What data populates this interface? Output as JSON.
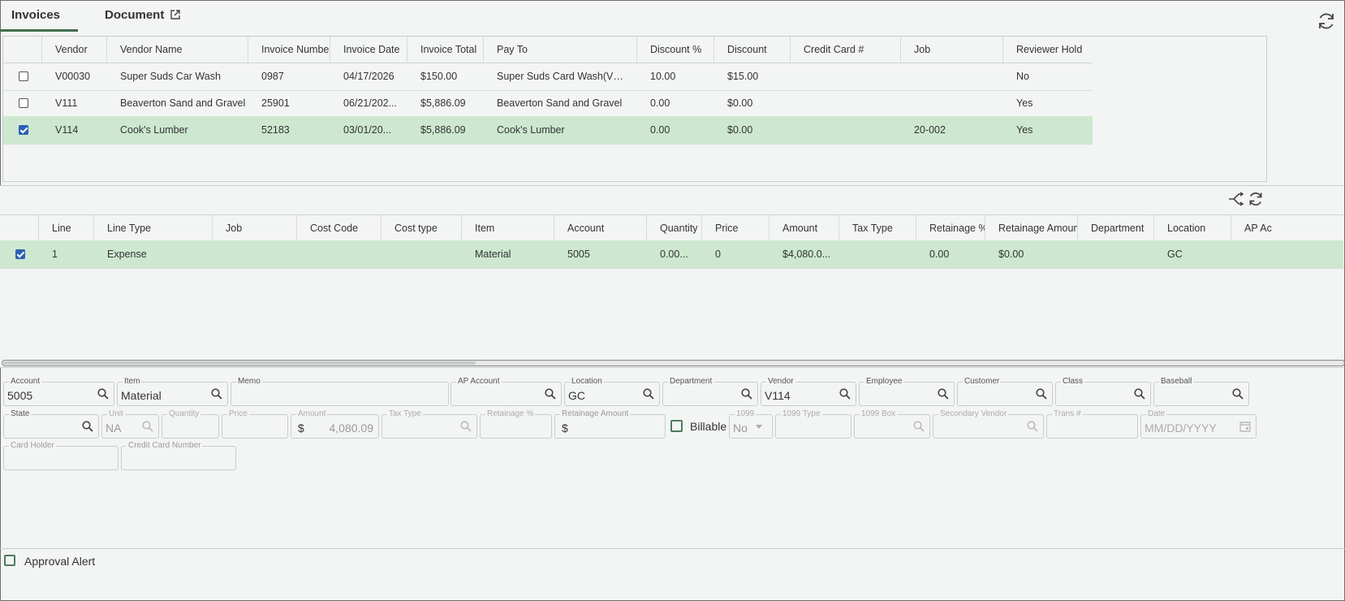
{
  "tabs": [
    {
      "label": "Invoices"
    },
    {
      "label": "Document"
    }
  ],
  "invoices": {
    "columns": [
      "Vendor",
      "Vendor Name",
      "Invoice Number",
      "Invoice Date",
      "Invoice Total",
      "Pay To",
      "Discount %",
      "Discount",
      "Credit Card #",
      "Job",
      "Reviewer Hold"
    ],
    "rows": [
      {
        "checked": false,
        "cells": [
          "V00030",
          "Super Suds Car Wash",
          "0987",
          "04/17/2026",
          "$150.00",
          "Super Suds Card Wash(VV0...",
          "10.00",
          "$15.00",
          "",
          "",
          "No"
        ]
      },
      {
        "checked": false,
        "cells": [
          "V111",
          "Beaverton Sand and Gravel",
          "25901",
          "06/21/202...",
          "$5,886.09",
          "Beaverton Sand and Gravel",
          "0.00",
          "$0.00",
          "",
          "",
          "Yes"
        ]
      },
      {
        "checked": true,
        "cells": [
          "V114",
          "Cook's Lumber",
          "52183",
          "03/01/20...",
          "$5,886.09",
          "Cook's Lumber",
          "0.00",
          "$0.00",
          "",
          "20-002",
          "Yes"
        ]
      }
    ]
  },
  "lines": {
    "columns": [
      "Line",
      "Line Type",
      "Job",
      "Cost Code",
      "Cost type",
      "Item",
      "Account",
      "Quantity",
      "Price",
      "Amount",
      "Tax Type",
      "Retainage %",
      "Retainage Amount",
      "Department",
      "Location",
      "AP Ac"
    ],
    "rows": [
      {
        "checked": true,
        "cells": [
          "1",
          "Expense",
          "",
          "",
          "",
          "Material",
          "5005",
          "0.00...",
          "0",
          "$4,080.0...",
          "",
          "0.00",
          "$0.00",
          "",
          "GC",
          ""
        ]
      }
    ]
  },
  "form": {
    "account": {
      "label": "Account",
      "value": "5005"
    },
    "item": {
      "label": "Item",
      "value": "Material"
    },
    "memo": {
      "label": "Memo",
      "value": ""
    },
    "ap_account": {
      "label": "AP Account",
      "value": ""
    },
    "location": {
      "label": "Location",
      "value": "GC"
    },
    "department": {
      "label": "Department",
      "value": ""
    },
    "vendor": {
      "label": "Vendor",
      "value": "V114"
    },
    "employee": {
      "label": "Employee",
      "value": ""
    },
    "customer": {
      "label": "Customer",
      "value": ""
    },
    "class": {
      "label": "Class",
      "value": ""
    },
    "baseball": {
      "label": "Baseball",
      "value": ""
    },
    "state": {
      "label": "State",
      "value": ""
    },
    "unit": {
      "label": "Unit",
      "value": "NA"
    },
    "quantity": {
      "label": "Quantity",
      "value": ""
    },
    "price": {
      "label": "Price",
      "value": ""
    },
    "amount": {
      "label": "Amount",
      "prefix": "$",
      "value": "4,080.09"
    },
    "tax_type": {
      "label": "Tax Type",
      "value": ""
    },
    "retainage_pct": {
      "label": "Retainage %",
      "value": ""
    },
    "retainage_amount": {
      "label": "Retainage Amount",
      "prefix": "$",
      "value": ""
    },
    "billable": {
      "label": "Billable"
    },
    "f1099": {
      "label": "1099",
      "value": "No"
    },
    "f1099_type": {
      "label": "1099 Type",
      "value": ""
    },
    "f1099_box": {
      "label": "1099 Box",
      "value": ""
    },
    "secondary_vendor": {
      "label": "Secondary Vendor",
      "value": ""
    },
    "trans_no": {
      "label": "Trans #",
      "value": ""
    },
    "date": {
      "label": "Date",
      "placeholder": "MM/DD/YYYY"
    },
    "card_holder": {
      "label": "Card Holder",
      "value": ""
    },
    "cc_number": {
      "label": "Credit Card Number",
      "value": ""
    }
  },
  "footer": {
    "approval_alert": "Approval Alert"
  }
}
